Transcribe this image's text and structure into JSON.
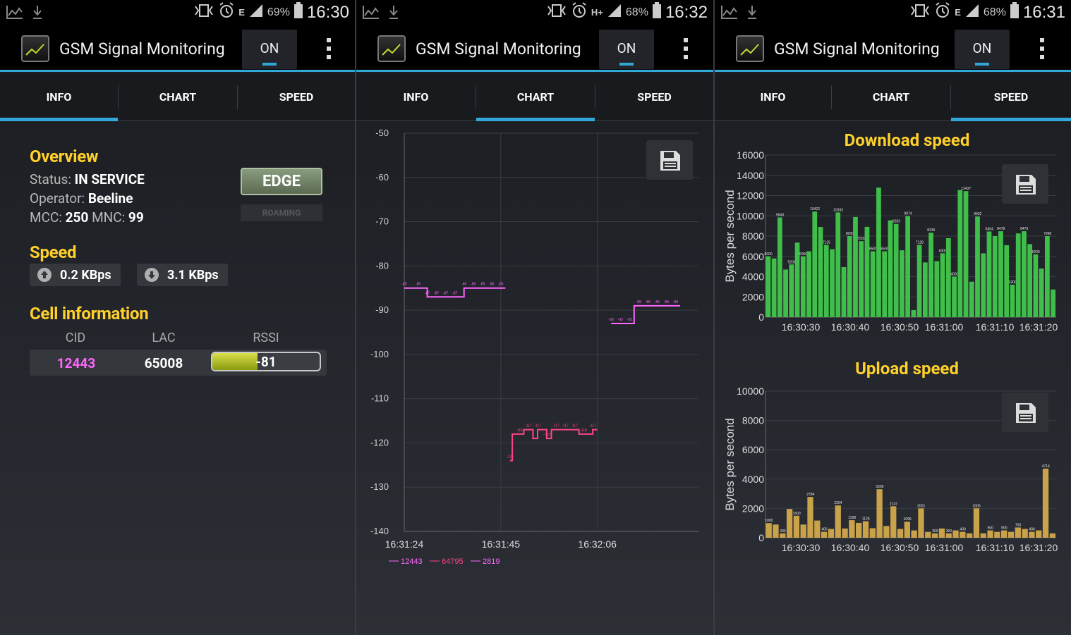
{
  "statusbars": [
    {
      "battery": "69%",
      "time": "16:30",
      "network": "E"
    },
    {
      "battery": "68%",
      "time": "16:32",
      "network": "H+"
    },
    {
      "battery": "68%",
      "time": "16:31",
      "network": "E"
    }
  ],
  "app": {
    "title": "GSM Signal Monitoring",
    "toggle_label": "ON"
  },
  "tabs": [
    "INFO",
    "CHART",
    "SPEED"
  ],
  "info": {
    "overview_title": "Overview",
    "status_label": "Status:",
    "status_value": "IN SERVICE",
    "operator_label": "Operator:",
    "operator_value": "Beeline",
    "mcc_label": "MCC:",
    "mcc_value": "250",
    "mnc_label": "MNC:",
    "mnc_value": "99",
    "network_type": "EDGE",
    "roaming": "ROAMING",
    "speed_title": "Speed",
    "upload": "0.2 KBps",
    "download": "3.1 KBps",
    "cell_title": "Cell information",
    "cols": [
      "CID",
      "LAC",
      "RSSI"
    ],
    "cid": "12443",
    "lac": "65008",
    "rssi": "-81",
    "rssi_level": 0.42,
    "colors": {
      "accent": "#32a8d8",
      "heading": "#ffd02a",
      "cid": "#ff66ff"
    }
  },
  "chart_data": [
    {
      "type": "line",
      "yticks": [
        "-50",
        "-60",
        "-70",
        "-80",
        "-90",
        "-100",
        "-110",
        "-120",
        "-130",
        "-140"
      ],
      "xticks": [
        "16:31:24",
        "16:31:45",
        "16:32:06"
      ],
      "ylim": [
        -140,
        -50
      ],
      "legend": [
        "12443",
        "64795",
        "2819"
      ],
      "series": [
        {
          "name": "12443",
          "color": "#ff66ff",
          "x": [
            0,
            2,
            3,
            4,
            5,
            6,
            7,
            8,
            9,
            10,
            11,
            12,
            13,
            14,
            15,
            16,
            17,
            18,
            19,
            20,
            21,
            22
          ],
          "values": [
            -85,
            -85,
            -85,
            -85,
            -87,
            -87,
            -87,
            -87,
            -87,
            -87,
            -87,
            -87,
            -85,
            -85,
            -85,
            -85,
            -85,
            -85,
            -85,
            -85,
            -85,
            -85
          ]
        },
        {
          "name": "64795",
          "color": "#ff4488",
          "x": [
            23,
            23.5,
            25,
            26,
            27,
            28,
            29,
            30,
            31,
            32,
            33,
            34,
            35,
            36,
            37,
            38,
            39,
            40,
            41,
            42
          ],
          "values": [
            -124,
            -118,
            -118,
            -117,
            -117,
            -119,
            -117,
            -117,
            -119,
            -117,
            -117,
            -117,
            -117,
            -117,
            -117,
            -118,
            -118,
            -118,
            -117,
            -117
          ]
        },
        {
          "name": "2819",
          "color": "#ff66ff",
          "x": [
            45,
            46,
            47,
            48,
            49,
            50,
            51,
            52,
            53,
            54,
            55,
            56,
            57,
            58,
            59,
            60
          ],
          "values": [
            -93,
            -93,
            -93,
            -93,
            -93,
            -89,
            -89,
            -89,
            -89,
            -89,
            -89,
            -89,
            -89,
            -89,
            -89,
            -89
          ]
        }
      ]
    },
    {
      "type": "bar",
      "title": "Download speed",
      "ylabel": "Bytes per second",
      "yticks": [
        "16000",
        "14000",
        "12000",
        "10000",
        "8000",
        "6000",
        "4000",
        "2000",
        "0"
      ],
      "xticks": [
        "16:30:30",
        "16:30:40",
        "16:30:50",
        "16:31:00",
        "16:31:10",
        "16:31:20"
      ],
      "ylim": [
        0,
        16000
      ],
      "color": "#3fbf4a",
      "values": [
        6000,
        5800,
        9843,
        4700,
        5200,
        7363,
        6000,
        6500,
        10422,
        8899,
        7135,
        6700,
        10333,
        4941,
        8000,
        9884,
        7500,
        8913,
        6500,
        12786,
        6500,
        9555,
        9203,
        6600,
        9974,
        700,
        7128,
        5400,
        8335,
        5526,
        6300,
        7793,
        4000,
        12545,
        12437,
        3500,
        9932,
        6300,
        8454,
        8000,
        8478,
        7102,
        3200,
        8264,
        8479,
        7213,
        6200,
        4800,
        7998,
        2729
      ]
    },
    {
      "type": "bar",
      "title": "Upload speed",
      "ylabel": "Bytes per second",
      "yticks": [
        "10000",
        "8000",
        "6000",
        "4000",
        "2000",
        "0"
      ],
      "xticks": [
        "16:30:30",
        "16:30:40",
        "16:30:50",
        "16:31:00",
        "16:31:10",
        "16:31:20"
      ],
      "ylim": [
        0,
        10000
      ],
      "color": "#c9a24a",
      "values": [
        1000,
        900,
        300,
        1964,
        1500,
        900,
        2784,
        1174,
        400,
        600,
        2204,
        631,
        1198,
        1010,
        1126,
        650,
        3309,
        800,
        2147,
        600,
        1095,
        500,
        2001,
        400,
        300,
        631,
        300,
        500,
        400,
        300,
        2005,
        300,
        500,
        400,
        500,
        400,
        700,
        600,
        400,
        500,
        4714,
        300
      ]
    }
  ]
}
